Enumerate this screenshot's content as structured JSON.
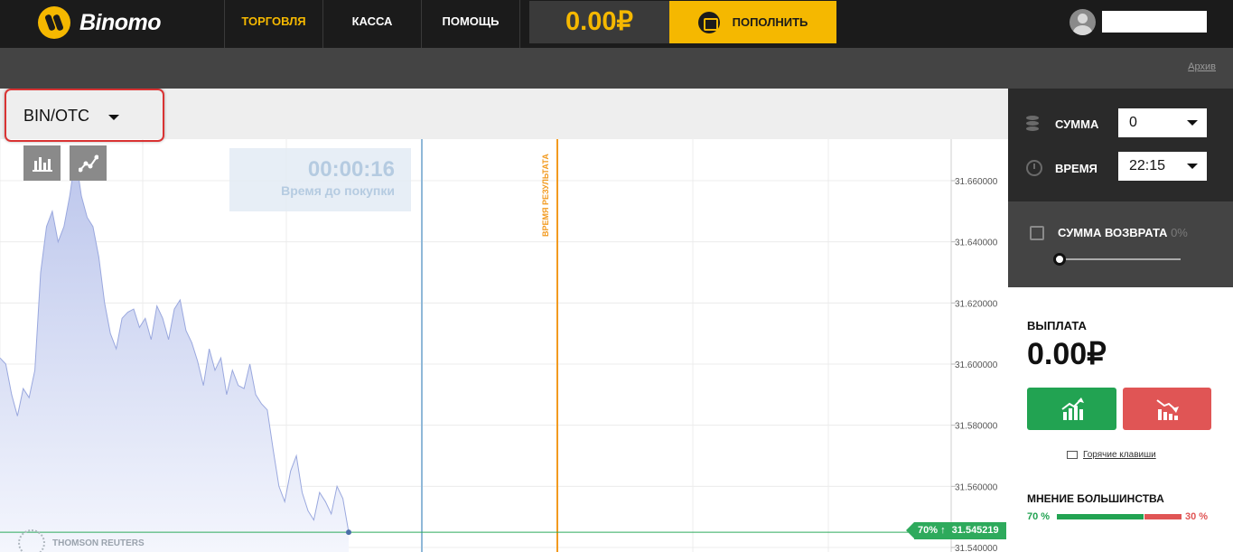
{
  "brand": {
    "name": "Binomo"
  },
  "nav": {
    "items": [
      "ТОРГОВЛЯ",
      "КАССА",
      "ПОМОЩЬ"
    ],
    "active": "ТОРГОВЛЯ"
  },
  "balance": {
    "value": "0.00₽"
  },
  "deposit": {
    "label": "ПОПОЛНИТЬ"
  },
  "subbar": {
    "archive": "Архив"
  },
  "asset": {
    "name": "BIN/OTC"
  },
  "timer": {
    "value": "00:00:16",
    "label": "Время до покупки"
  },
  "result_marker": {
    "label": "ВРЕМЯ РЕЗУЛЬТАТА"
  },
  "price_axis": {
    "ticks": [
      "31.660000",
      "31.640000",
      "31.620000",
      "31.600000",
      "31.580000",
      "31.560000",
      "31.540000"
    ]
  },
  "current_price": {
    "pct": "70%",
    "arrow": "↑",
    "value": "31.545219"
  },
  "provider": {
    "name": "THOMSON REUTERS"
  },
  "trade": {
    "amount_label": "СУММА",
    "amount_value": "0",
    "time_label": "ВРЕМЯ",
    "time_value": "22:15",
    "refund_label": "СУММА ВОЗВРАТА",
    "refund_pct": "0%",
    "refund_level": 0
  },
  "payout": {
    "label": "ВЫПЛАТА",
    "value": "0.00₽"
  },
  "hotkeys": {
    "label": "Горячие клавиши"
  },
  "majority": {
    "label": "МНЕНИЕ БОЛЬШИНСТВА",
    "up": "70 %",
    "down": "30 %",
    "up_fraction": 0.7
  },
  "colors": {
    "accent": "#f5b800",
    "up": "#22a352",
    "down": "#e05555",
    "result_line": "#f29a1f"
  },
  "chart_data": {
    "type": "area",
    "ylim": [
      31.535,
      31.67
    ],
    "y": [
      31.602,
      31.6,
      31.59,
      31.583,
      31.592,
      31.589,
      31.598,
      31.63,
      31.645,
      31.65,
      31.64,
      31.645,
      31.655,
      31.668,
      31.655,
      31.648,
      31.645,
      31.635,
      31.62,
      31.61,
      31.605,
      31.615,
      31.617,
      31.618,
      31.612,
      31.615,
      31.608,
      31.619,
      31.615,
      31.608,
      31.618,
      31.621,
      31.611,
      31.607,
      31.601,
      31.593,
      31.605,
      31.598,
      31.602,
      31.59,
      31.598,
      31.593,
      31.592,
      31.6,
      31.59,
      31.587,
      31.585,
      31.572,
      31.56,
      31.555,
      31.565,
      31.57,
      31.558,
      31.552,
      31.549,
      31.558,
      31.555,
      31.551,
      31.56,
      31.556,
      31.545
    ]
  }
}
